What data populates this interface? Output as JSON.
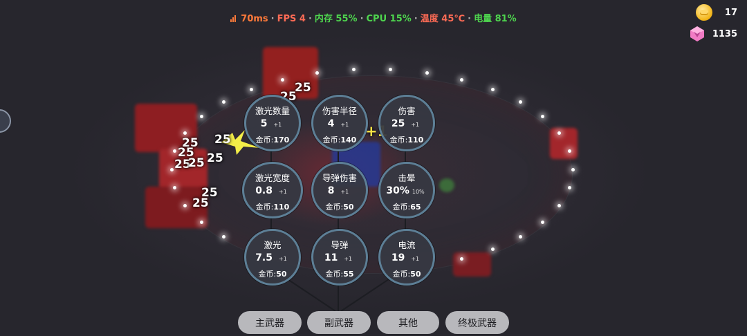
{
  "status_bar": {
    "ping": "70ms",
    "fps": "FPS 4",
    "memory": "内存 55%",
    "cpu": "CPU 15%",
    "temperature": "温度 45℃",
    "battery": "电量 81%",
    "separator": "·"
  },
  "currency": {
    "coins": "17",
    "gems": "1135"
  },
  "battle_text": {
    "damage_numbers": [
      "25",
      "25",
      "25",
      "25",
      "25",
      "25",
      "25",
      "25",
      "25",
      "25"
    ],
    "pickup": "+1"
  },
  "upgrades": {
    "cost_label": "金币",
    "cost_sep": ":",
    "nodes": [
      {
        "title": "激光数量",
        "value": "5",
        "inc": "+1",
        "cost": "170"
      },
      {
        "title": "伤害半径",
        "value": "4",
        "inc": "+1",
        "cost": "140"
      },
      {
        "title": "伤害",
        "value": "25",
        "inc": "+1",
        "cost": "110"
      },
      {
        "title": "激光宽度",
        "value": "0.8",
        "inc": "+1",
        "cost": "110"
      },
      {
        "title": "导弹伤害",
        "value": "8",
        "inc": "+1",
        "cost": "50"
      },
      {
        "title": "击晕",
        "value": "30%",
        "inc": "10%",
        "cost": "65"
      },
      {
        "title": "激光",
        "value": "7.5",
        "inc": "+1",
        "cost": "50"
      },
      {
        "title": "导弹",
        "value": "11",
        "inc": "+1",
        "cost": "55"
      },
      {
        "title": "电流",
        "value": "19",
        "inc": "+1",
        "cost": "50"
      }
    ]
  },
  "tabs": [
    {
      "label": "主武器"
    },
    {
      "label": "副武器"
    },
    {
      "label": "其他"
    },
    {
      "label": "终极武器"
    }
  ],
  "colors": {
    "node_border": "#5d7f96",
    "tab_bg": "#b8b8bc",
    "good": "#4ed44e",
    "warn": "#ff6b55"
  }
}
